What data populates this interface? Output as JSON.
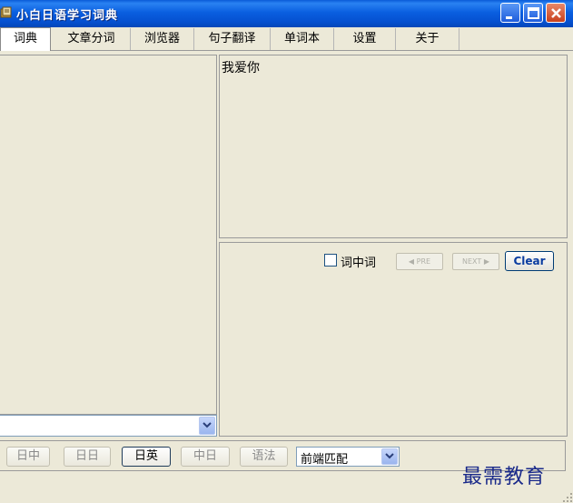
{
  "window": {
    "title": "小白日语学习词典",
    "icon": "book-icon"
  },
  "tabs": [
    {
      "label": "词典",
      "active": true
    },
    {
      "label": "文章分词",
      "active": false
    },
    {
      "label": "浏览器",
      "active": false
    },
    {
      "label": "句子翻译",
      "active": false
    },
    {
      "label": "单词本",
      "active": false
    },
    {
      "label": "设置",
      "active": false
    },
    {
      "label": "关于",
      "active": false
    }
  ],
  "meaning_panel": {
    "text": "我爱你"
  },
  "result_panel": {
    "checkbox_label": "词中词",
    "checked": false,
    "pre_label": "PRE",
    "next_label": "NEXT",
    "clear_label": "Clear"
  },
  "search": {
    "value": ""
  },
  "modes": [
    {
      "label": "日中",
      "selected": false
    },
    {
      "label": "日日",
      "selected": false
    },
    {
      "label": "日英",
      "selected": true
    },
    {
      "label": "中日",
      "selected": false
    },
    {
      "label": "语法",
      "selected": false
    }
  ],
  "match": {
    "selected": "前端匹配"
  },
  "watermark": "最需教育",
  "colors": {
    "titlebar": "#0a5fe0",
    "face": "#ece9d8",
    "clear_text": "#0a3ca0",
    "watermark": "#1a2a8a"
  }
}
